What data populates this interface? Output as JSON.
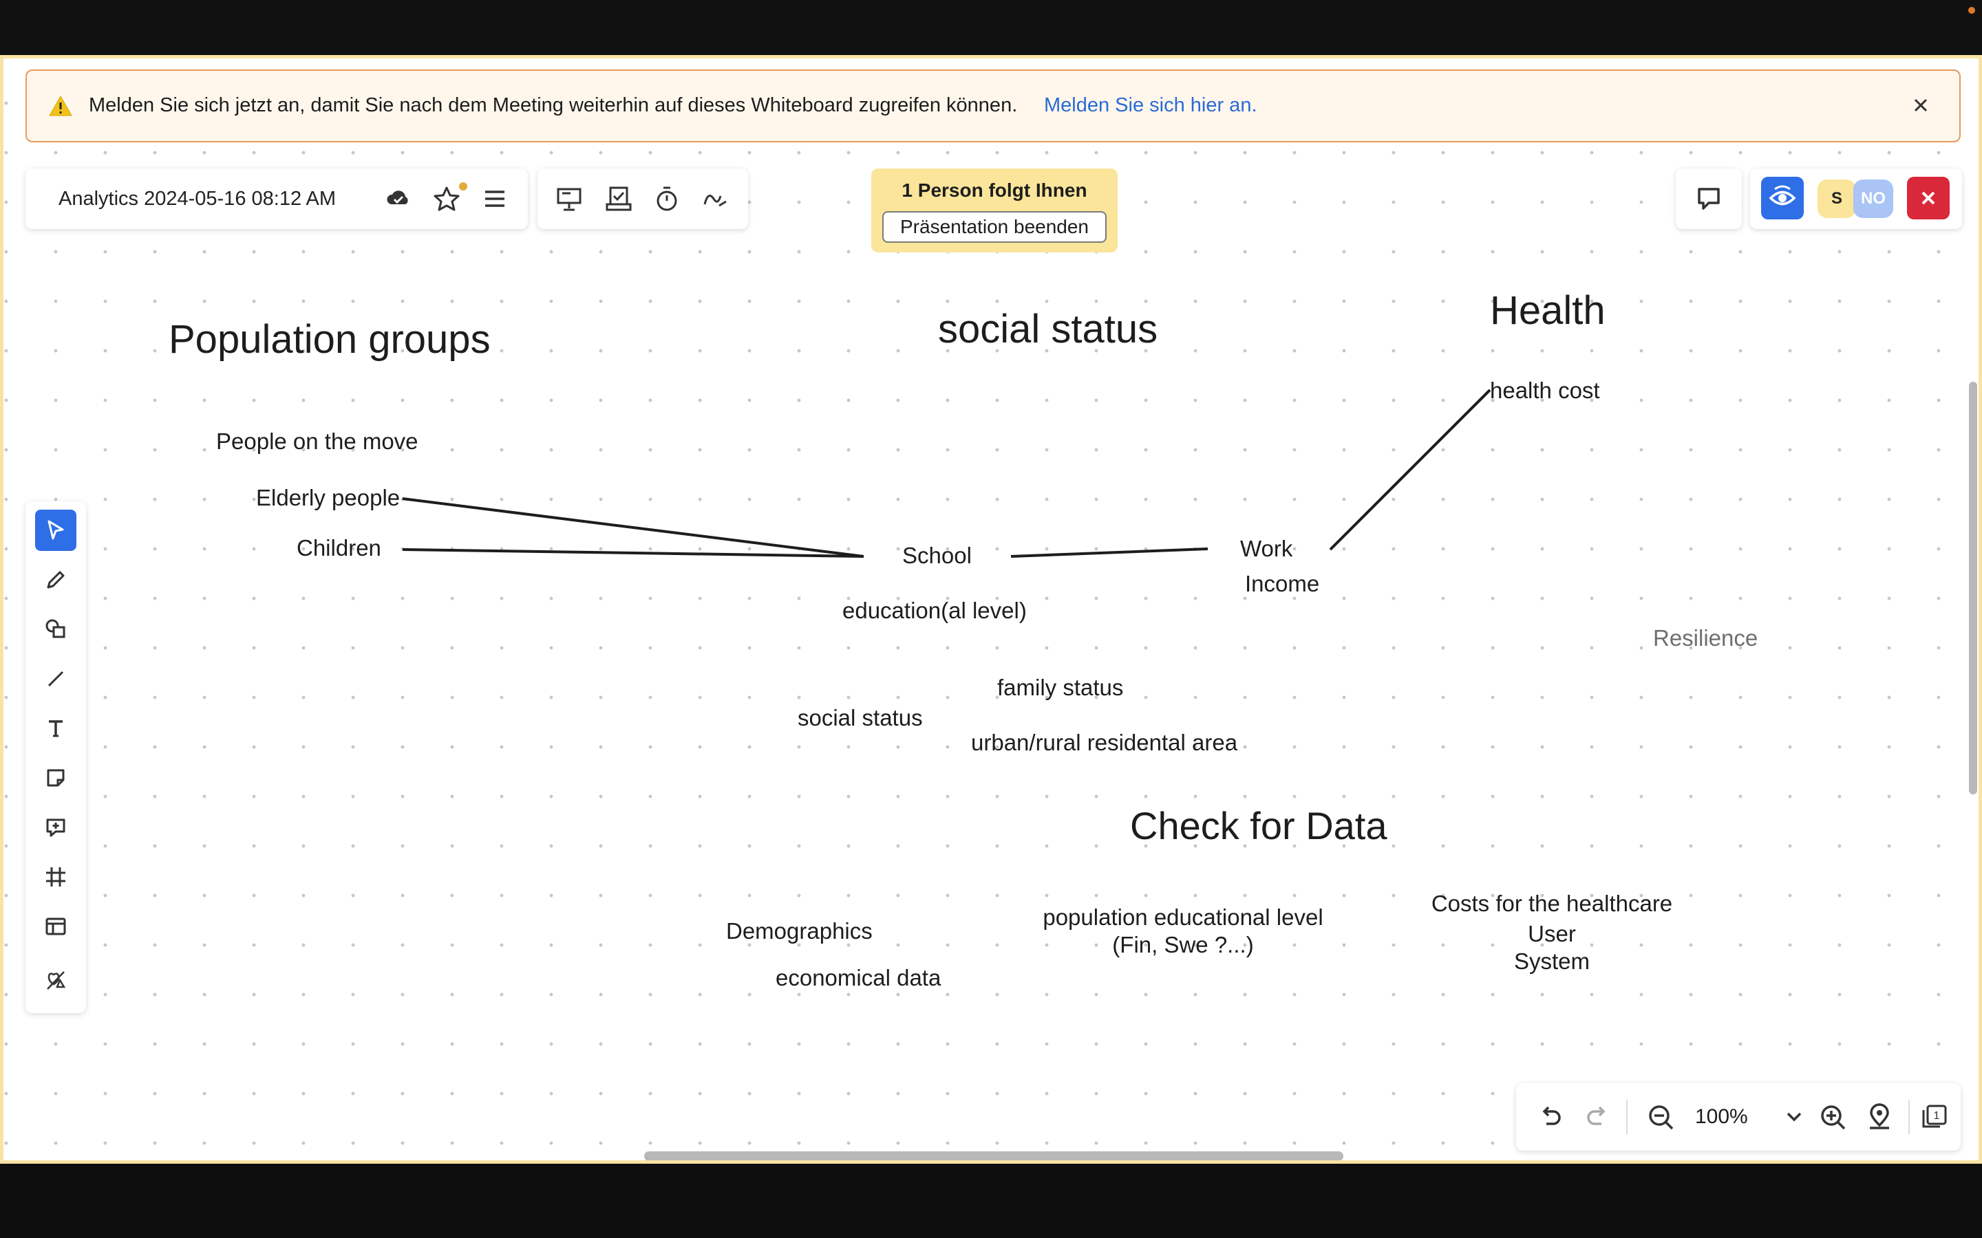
{
  "banner": {
    "message": "Melden Sie sich jetzt an, damit Sie nach dem Meeting weiterhin auf dieses Whiteboard zugreifen können.",
    "link": "Melden Sie sich hier an."
  },
  "header": {
    "board_title": "Analytics 2024-05-16 08:12 AM"
  },
  "presentation": {
    "followers": "1 Person folgt Ihnen",
    "end_button": "Präsentation beenden"
  },
  "collaborators": {
    "avatars": [
      "S",
      "NO"
    ]
  },
  "canvas": {
    "headings": {
      "population_groups": "Population groups",
      "social_status": "social status",
      "health": "Health",
      "check_for_data": "Check for Data"
    },
    "notes": {
      "people_on_the_move": "People on the move",
      "elderly_people": "Elderly people",
      "children": "Children",
      "school": "School",
      "education": "education(al level)",
      "work": "Work",
      "income": "Income",
      "health_cost": "health cost",
      "resilience": "Resilience",
      "family_status": "family status",
      "social_status_small": "social status",
      "urban_rural": "urban/rural residental area",
      "demographics": "Demographics",
      "economical_data": "economical data",
      "population_educational_level": "population educational level",
      "fin_swe": "(Fin, Swe ?...)",
      "costs_healthcare": "Costs for the healthcare",
      "user": "User",
      "system": "System"
    }
  },
  "zoom": {
    "value": "100%",
    "pages_badge": "1"
  },
  "colors": {
    "accent": "#2e6ee6",
    "frame": "#f8e3a2",
    "follow_box": "#fbe59a",
    "close_red": "#d9283a",
    "link": "#2a6bd6"
  },
  "icons": {
    "tools": [
      "select-icon",
      "pen-icon",
      "shapes-icon",
      "line-icon",
      "text-icon",
      "sticky-note-icon",
      "comment-icon",
      "frame-icon",
      "template-icon",
      "ai-shapes-icon"
    ]
  }
}
